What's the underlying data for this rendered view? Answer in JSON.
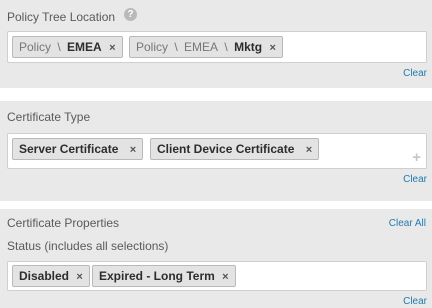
{
  "policy_tree": {
    "title": "Policy Tree Location",
    "help_icon": "?",
    "chips": [
      {
        "prefix": "Policy",
        "sep": "\\",
        "name": "EMEA"
      },
      {
        "prefix": "Policy",
        "sep": "\\",
        "middle": "EMEA",
        "sep2": "\\",
        "name": "Mktg"
      }
    ],
    "remove_glyph": "×",
    "clear_label": "Clear"
  },
  "certificate_type": {
    "title": "Certificate Type",
    "chips": [
      "Server Certificate",
      "Client Device Certificate"
    ],
    "remove_glyph": "×",
    "add_glyph": "+",
    "clear_label": "Clear"
  },
  "certificate_properties": {
    "title": "Certificate Properties",
    "clear_all_label": "Clear All",
    "status_label": "Status (includes all selections)",
    "chips": [
      "Disabled",
      "Expired - Long Term"
    ],
    "remove_glyph": "×",
    "clear_label": "Clear"
  }
}
